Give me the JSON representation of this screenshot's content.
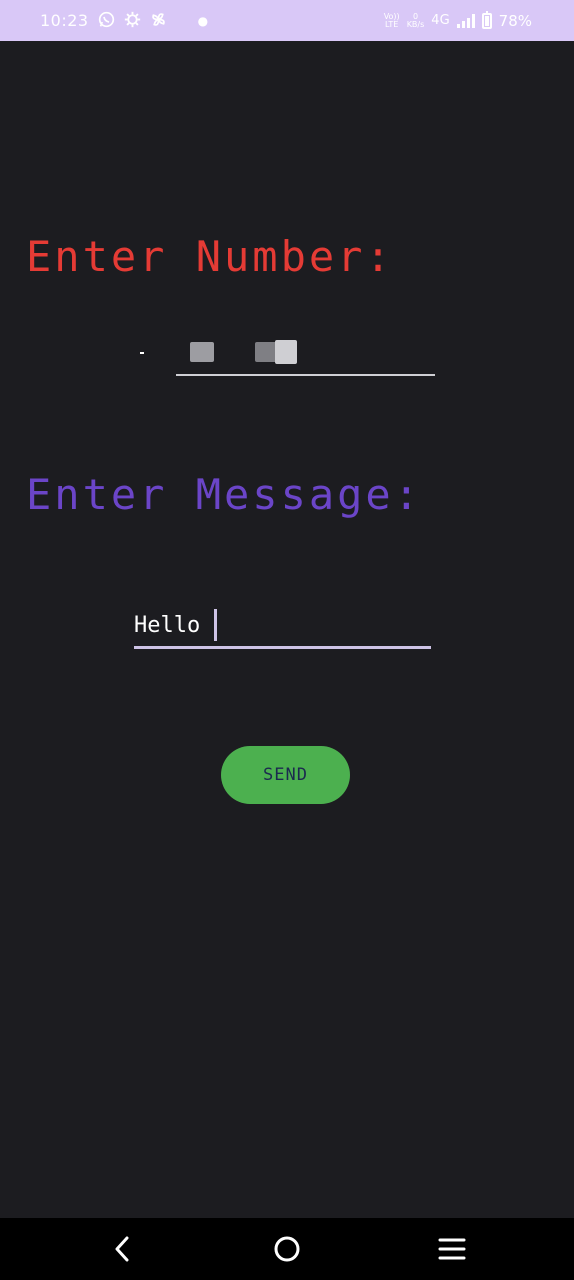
{
  "status_bar": {
    "time": "10:23",
    "icons_left": [
      "whatsapp-icon",
      "settings-gear-icon",
      "pinwheel-icon"
    ],
    "volte_top": "Vo))",
    "volte_bottom": "LTE",
    "speed_top": "0",
    "speed_bottom": "KB/s",
    "network": "4G",
    "battery_percent": "78%",
    "battery_level": 0.78
  },
  "form": {
    "number_label": "Enter Number:",
    "message_label": "Enter Message:",
    "message_value": "Hello",
    "send_label": "SEND"
  },
  "colors": {
    "number_label": "#e53b35",
    "message_label": "#6b45c8",
    "send_button": "#4cb04f",
    "background": "#1c1c20",
    "status_bar": "#d9c8f7"
  },
  "nav_bar": {
    "icons": [
      "back-icon",
      "home-icon",
      "menu-icon"
    ]
  }
}
